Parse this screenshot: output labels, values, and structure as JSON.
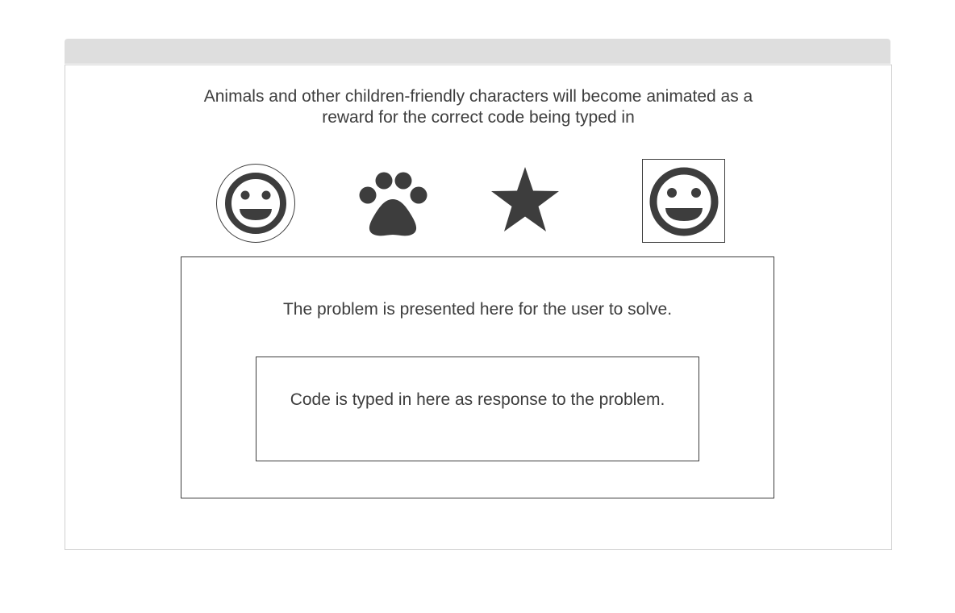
{
  "intro": {
    "text": "Animals and other children-friendly characters will become animated as a reward for the correct code being typed in"
  },
  "characters": [
    {
      "icon": "smiley-icon",
      "frame": "circle"
    },
    {
      "icon": "paw-icon",
      "frame": "none"
    },
    {
      "icon": "star-icon",
      "frame": "none"
    },
    {
      "icon": "smiley-icon",
      "frame": "square"
    }
  ],
  "problem": {
    "text": "The problem is presented here for the user to solve."
  },
  "code_input": {
    "text": "Code is typed in here as response to the problem."
  },
  "colors": {
    "icon": "#3d3d3d",
    "titlebar": "#dedede",
    "border": "#3d3d3d"
  }
}
